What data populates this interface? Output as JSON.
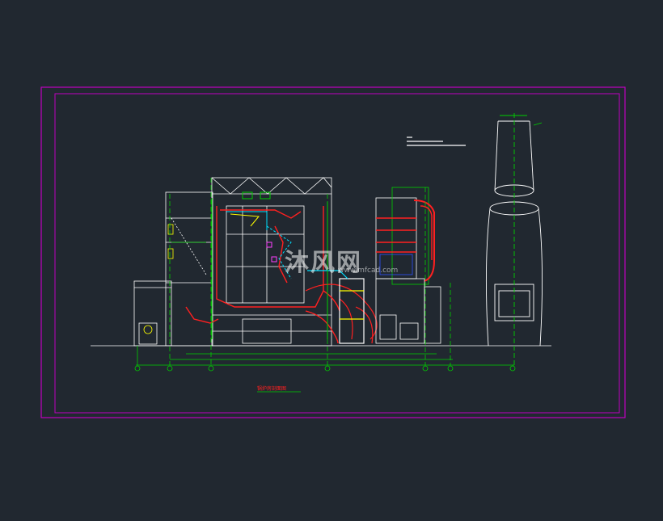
{
  "colors": {
    "background": "#212830",
    "frame": "#c000c0",
    "structure": "#ffffff",
    "pipe_red": "#ff2020",
    "pipe_green": "#00d000",
    "accent_yellow": "#ffff00",
    "accent_cyan": "#00e0ff",
    "accent_blue": "#3050ff",
    "accent_magenta": "#ff40ff"
  },
  "drawing": {
    "caption": "锅炉房剖面图",
    "watermark_text": "沐风网",
    "watermark_url": "www.mfcad.com",
    "axis_markers": [
      "①",
      "②",
      "③",
      "④",
      "⑤",
      "⑥",
      "⑦"
    ]
  }
}
